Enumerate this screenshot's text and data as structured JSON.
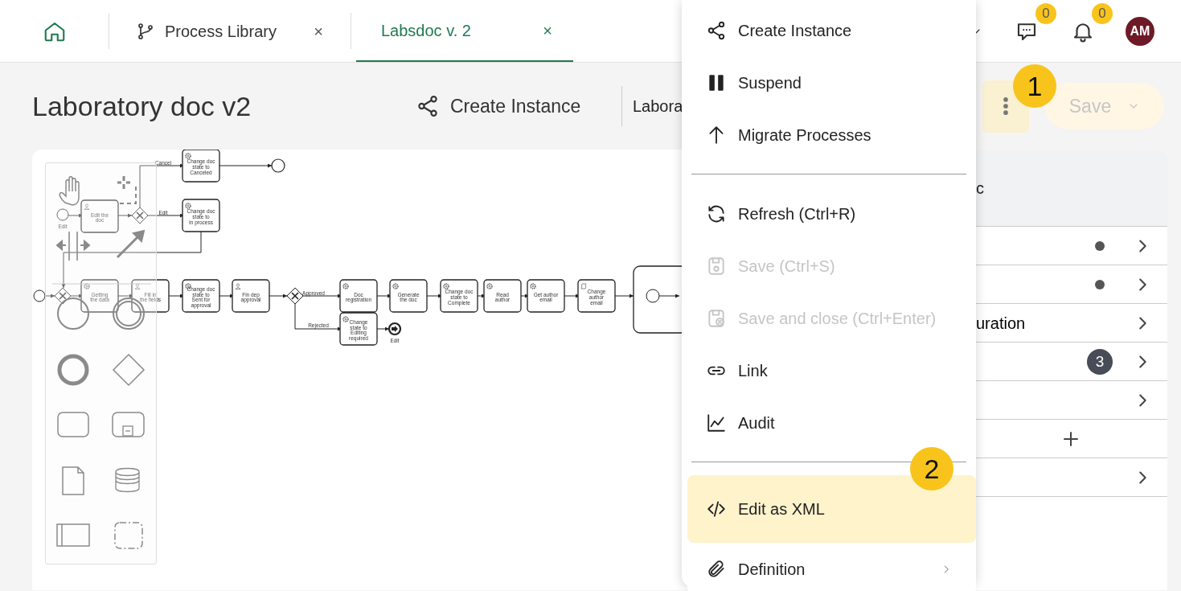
{
  "top_bar": {
    "tabs": [
      {
        "label": "Process Library",
        "selected": false,
        "close": "×"
      },
      {
        "label": "Labsdoc v. 2",
        "selected": true,
        "close": "×"
      }
    ],
    "chat_badge": "0",
    "notification_badge": "0",
    "avatar": "AM"
  },
  "header": {
    "title": "Laboratory doc v2",
    "create_instance": "Create Instance",
    "version": "Labora",
    "save": {
      "label": "Save",
      "disabled": true
    }
  },
  "callouts": [
    "1",
    "2"
  ],
  "diagram": {
    "flow_labels": [
      "Cancel",
      "Edit",
      "Approved",
      "Rejected"
    ],
    "event_labels": [
      "Edit",
      "Edit"
    ],
    "tasks": [
      {
        "label": "Change doc state to Canceled",
        "kind": "service"
      },
      {
        "label": "Edit the doc",
        "kind": "user"
      },
      {
        "label": "Change doc state to In process",
        "kind": "service"
      },
      {
        "label": "Getting the data",
        "kind": "service"
      },
      {
        "label": "Fill in the fields",
        "kind": "user"
      },
      {
        "label": "Change doc state to Sent for approval",
        "kind": "service"
      },
      {
        "label": "Fin dep approval",
        "kind": "user"
      },
      {
        "label": "Doc registration",
        "kind": "service"
      },
      {
        "label": "Generate the doc",
        "kind": "service"
      },
      {
        "label": "Change doc state to Complete",
        "kind": "service"
      },
      {
        "label": "Read author",
        "kind": "service"
      },
      {
        "label": "Get author email",
        "kind": "service"
      },
      {
        "label": "Change author email",
        "kind": "script"
      },
      {
        "label": "Change state to Editing required",
        "kind": "service"
      }
    ]
  },
  "side_panel": {
    "title": "c",
    "rows": [
      {
        "kind": "link",
        "dot": true
      },
      {
        "kind": "link",
        "dot": true
      },
      {
        "kind": "link",
        "dot": false,
        "label": "uration"
      },
      {
        "kind": "link",
        "dot": false,
        "badge": "3"
      },
      {
        "kind": "link",
        "dot": false
      },
      {
        "kind": "add"
      },
      {
        "kind": "link",
        "dot": false
      }
    ]
  },
  "menu": {
    "items": [
      {
        "kind": "item",
        "label": "Create Instance",
        "disabled": false,
        "selected": false,
        "submenu": false
      },
      {
        "kind": "item",
        "label": "Suspend",
        "disabled": false,
        "selected": false,
        "submenu": false
      },
      {
        "kind": "item",
        "label": "Migrate Processes",
        "disabled": false,
        "selected": false,
        "submenu": false
      },
      {
        "kind": "divider"
      },
      {
        "kind": "item",
        "label": "Refresh (Ctrl+R)",
        "disabled": false,
        "selected": false,
        "submenu": false
      },
      {
        "kind": "item",
        "label": "Save (Ctrl+S)",
        "disabled": true,
        "selected": false,
        "submenu": false
      },
      {
        "kind": "item",
        "label": "Save and close (Ctrl+Enter)",
        "disabled": true,
        "selected": false,
        "submenu": false
      },
      {
        "kind": "item",
        "label": "Link",
        "disabled": false,
        "selected": false,
        "submenu": false
      },
      {
        "kind": "item",
        "label": "Audit",
        "disabled": false,
        "selected": false,
        "submenu": false
      },
      {
        "kind": "divider"
      },
      {
        "kind": "item",
        "label": "Edit as XML",
        "disabled": false,
        "selected": true,
        "submenu": false
      },
      {
        "kind": "item",
        "label": "Definition",
        "disabled": false,
        "selected": false,
        "submenu": true
      }
    ]
  }
}
